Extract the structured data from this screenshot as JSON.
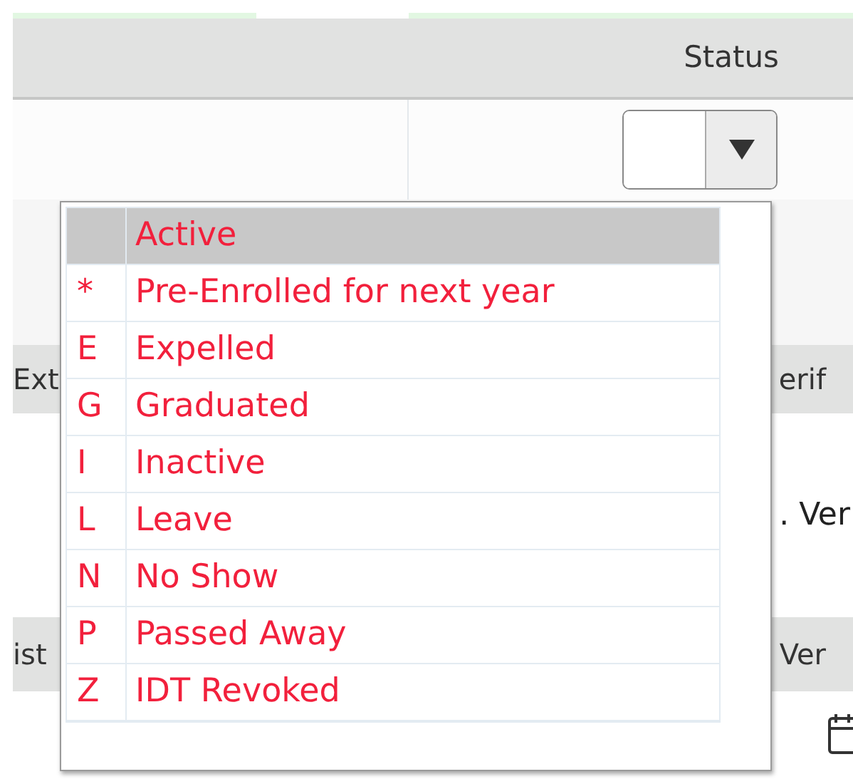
{
  "header": {
    "status_label": "Status"
  },
  "status_select": {
    "expanded": true
  },
  "grid_header_1": {
    "column_1": "Ext",
    "column_2": "erif"
  },
  "row_text": ". Ver",
  "grid_header_2": {
    "column_1": "ist",
    "column_2": "Ver"
  },
  "status_options": [
    {
      "label": "Active",
      "selected": true
    },
    {
      "code": "*",
      "label": "Pre-Enrolled for next year",
      "selected": false
    },
    {
      "code": "E",
      "label": "Expelled",
      "selected": false
    },
    {
      "code": "G",
      "label": "Graduated",
      "selected": false
    },
    {
      "code": "I",
      "label": "Inactive",
      "selected": false
    },
    {
      "code": "L",
      "label": "Leave",
      "selected": false
    },
    {
      "code": "N",
      "label": "No Show",
      "selected": false
    },
    {
      "code": "P",
      "label": "Passed Away",
      "selected": false
    },
    {
      "code": "Z",
      "label": "IDT Revoked",
      "selected": false
    }
  ]
}
